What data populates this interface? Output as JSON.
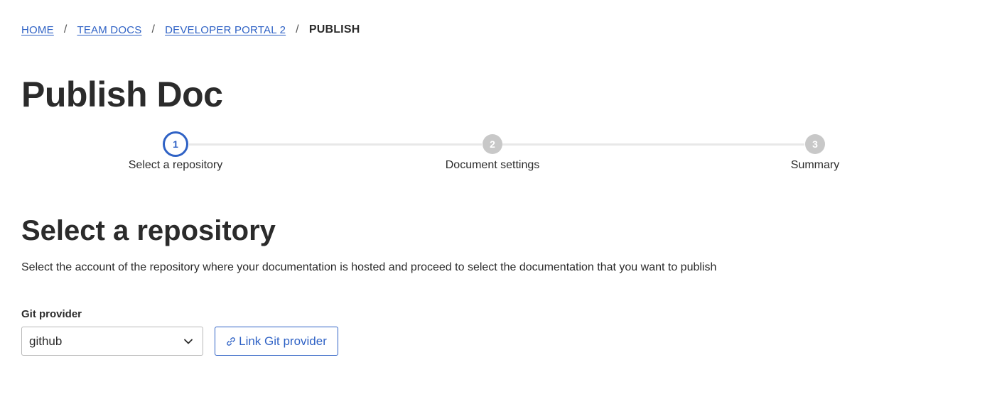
{
  "breadcrumb": {
    "items": [
      {
        "label": "HOME"
      },
      {
        "label": "TEAM DOCS"
      },
      {
        "label": "DEVELOPER PORTAL 2"
      }
    ],
    "separator": "/",
    "current": "PUBLISH"
  },
  "page": {
    "title": "Publish Doc"
  },
  "stepper": {
    "steps": [
      {
        "number": "1",
        "label": "Select a repository",
        "state": "active"
      },
      {
        "number": "2",
        "label": "Document settings",
        "state": "inactive"
      },
      {
        "number": "3",
        "label": "Summary",
        "state": "inactive"
      }
    ]
  },
  "section": {
    "title": "Select a repository",
    "description": "Select the account of the repository where your documentation is hosted and proceed to select the documentation that you want to publish"
  },
  "form": {
    "git_provider_label": "Git provider",
    "git_provider_value": "github",
    "link_button_label": "Link Git provider",
    "link_icon": "link-icon",
    "select_icon": "chevron-down-icon"
  },
  "colors": {
    "accent": "#2f62c5",
    "inactive_step": "#c8c8c8",
    "text": "#2b2b2b"
  }
}
